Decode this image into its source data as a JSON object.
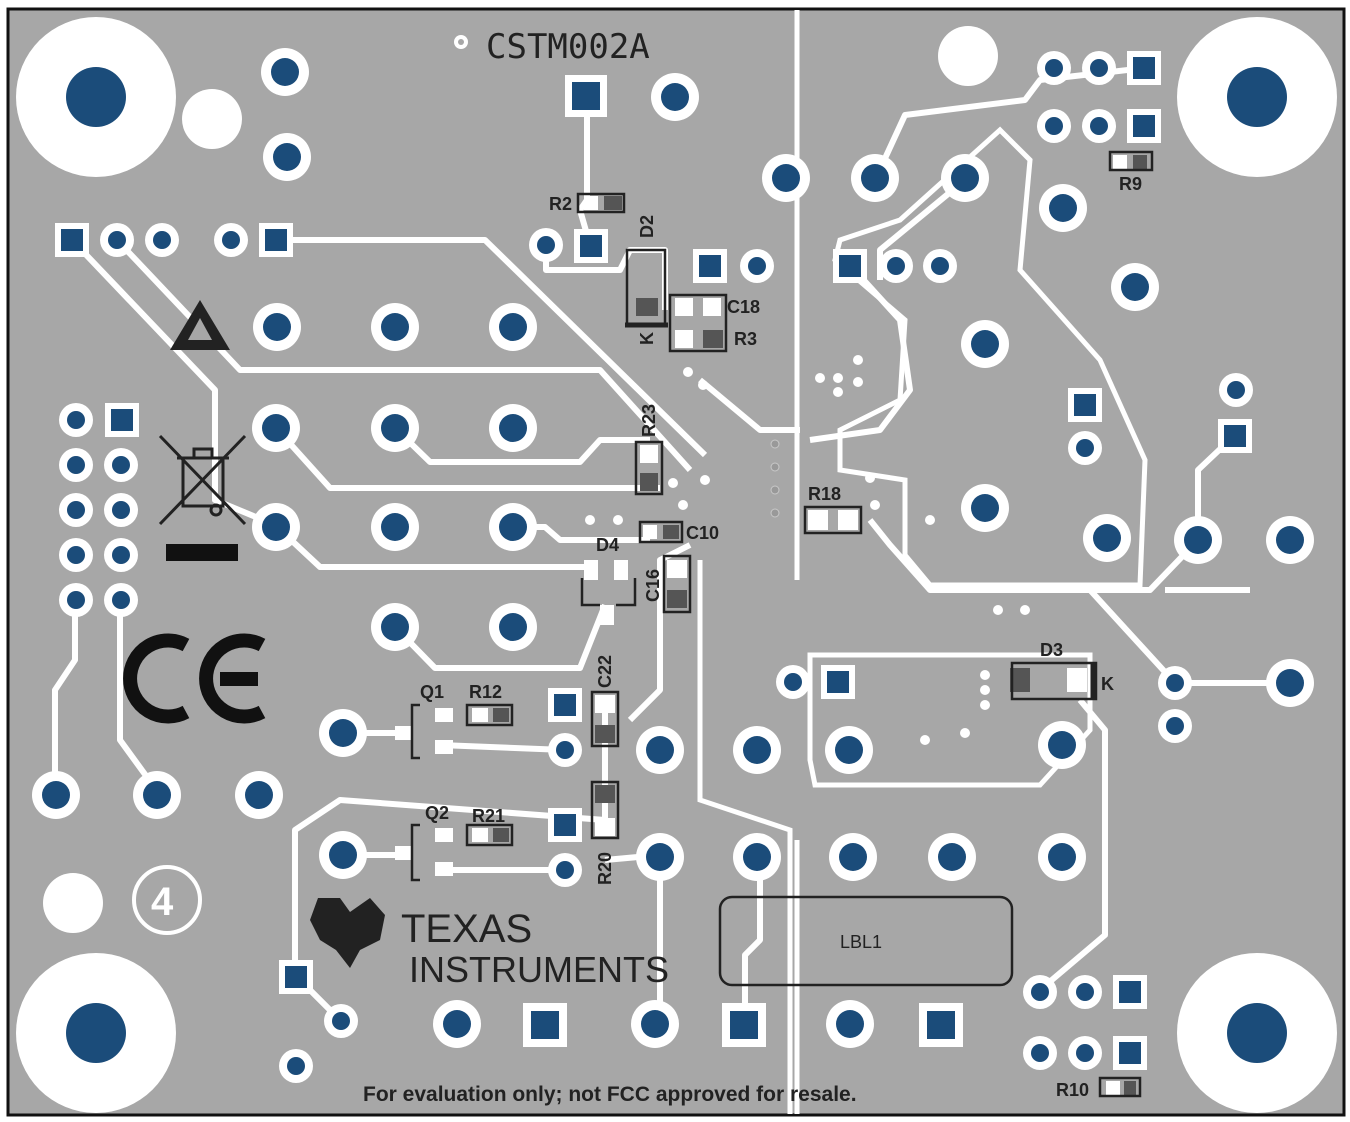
{
  "board": {
    "id": "CSTM002A",
    "disclaimer": "For evaluation only; not FCC approved for resale.",
    "layer_number": "4",
    "label_box": "LBL1",
    "logo_line1": "TEXAS",
    "logo_line2": "INSTRUMENTS"
  },
  "designators": {
    "R2": "R2",
    "D2": "D2",
    "C18": "C18",
    "R3": "R3",
    "K_D2": "K",
    "R23": "R23",
    "R18": "R18",
    "C10": "C10",
    "D4": "D4",
    "C16": "C16",
    "C22": "C22",
    "Q1": "Q1",
    "R12": "R12",
    "Q2": "Q2",
    "R21": "R21",
    "R20": "R20",
    "D3": "D3",
    "K_D3": "K",
    "R9": "R9",
    "R10": "R10"
  },
  "marks": {
    "ce": "CE",
    "esd": "esd-warning-icon",
    "weee": "weee-bin-icon"
  },
  "colors": {
    "board": "#a7a7a7",
    "pad": "#1b4c7a",
    "trace_outline": "#ffffff",
    "silkscreen": "#222222"
  }
}
